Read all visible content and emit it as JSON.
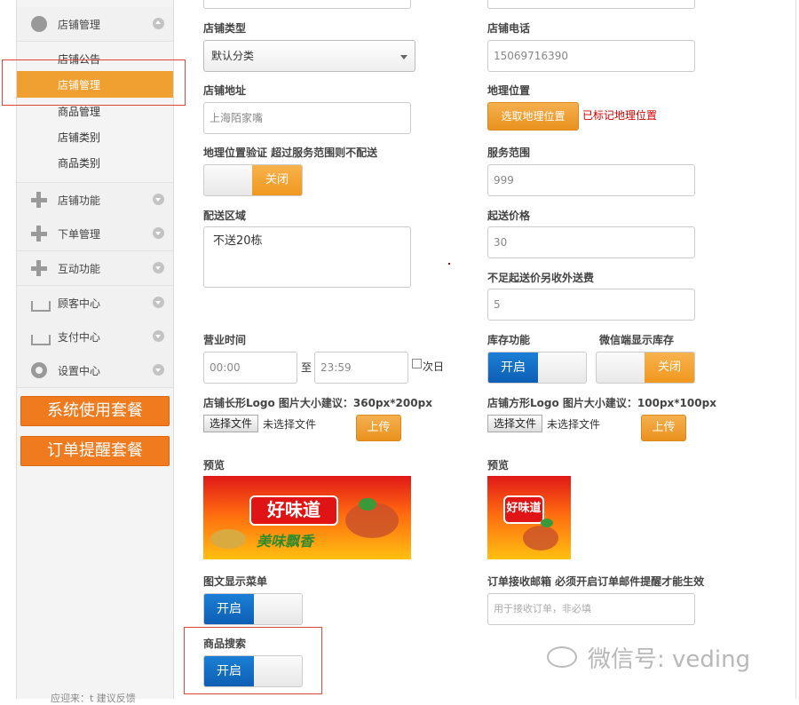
{
  "sidebar": {
    "store_section": "店铺管理",
    "sub_items": [
      "店铺公告",
      "店铺管理",
      "商品管理",
      "店铺类别",
      "商品类别"
    ],
    "sections": [
      "店铺功能",
      "下单管理",
      "互动功能",
      "顾客中心",
      "支付中心",
      "设置中心"
    ],
    "btn_system": "系统使用套餐",
    "btn_order": "订单提醒套餐",
    "footer": "应迎来：t 建议反馈"
  },
  "form": {
    "store_type_label": "店铺类型",
    "store_type_value": "默认分类",
    "store_phone_label": "店铺电话",
    "store_phone_value": "15069716390",
    "address_label": "店铺地址",
    "address_value": "上海陌家嘴",
    "geo_label": "地理位置",
    "geo_button": "选取地理位置",
    "geo_status": "已标记地理位置",
    "geo_verify_label": "地理位置验证 超过服务范围则不配送",
    "geo_verify_toggle": "关闭",
    "service_range_label": "服务范围",
    "service_range_value": "999",
    "delivery_area_label": "配送区域",
    "delivery_area_value": "不送20栋",
    "min_price_label": "起送价格",
    "min_price_value": "30",
    "extra_fee_label": "不足起送价另收外送费",
    "extra_fee_value": "5",
    "hours_label": "营业时间",
    "hours_start": "00:00",
    "hours_to": "至",
    "hours_end": "23:59",
    "next_day": "次日",
    "stock_label": "库存功能",
    "stock_toggle": "开启",
    "wechat_stock_label": "微信端显示库存",
    "wechat_stock_toggle": "关闭",
    "logo_long_label": "店铺长形Logo 图片大小建议：360px*200px",
    "logo_square_label": "店铺方形Logo 图片大小建议：100px*100px",
    "choose_file": "选择文件",
    "no_file": "未选择文件",
    "upload": "上传",
    "preview": "预览",
    "banner_brand": "好味道",
    "banner_slogan": "美味飘香",
    "menu_label": "图文显示菜单",
    "menu_toggle": "开启",
    "email_label": "订单接收邮箱 必须开启订单邮件提醒才能生效",
    "email_placeholder": "用于接收订单，非必填",
    "search_label": "商品搜索",
    "search_toggle": "开启"
  },
  "watermark": "微信号: veding",
  "colors": {
    "accent": "#f0a030",
    "primary": "#0d5fb3",
    "alert": "#d40000"
  }
}
